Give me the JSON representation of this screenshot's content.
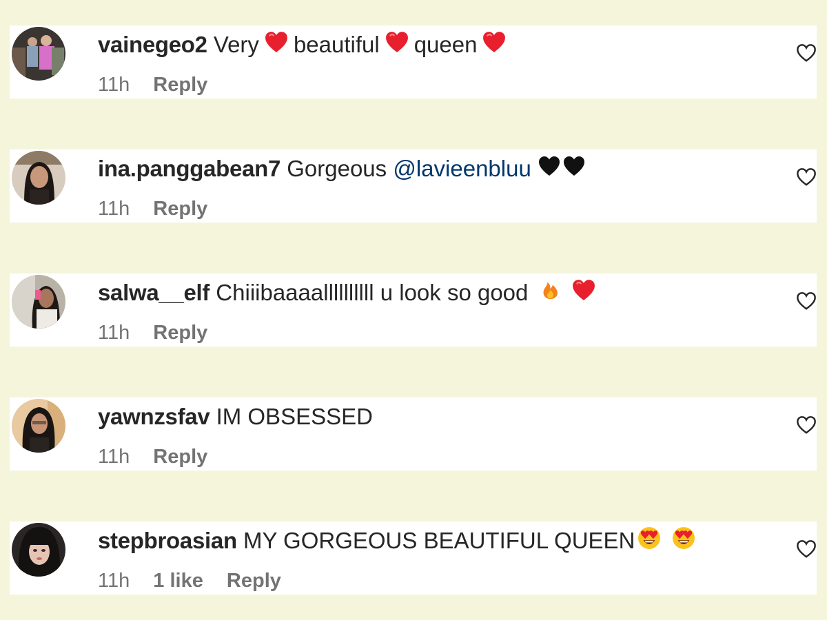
{
  "comments": [
    {
      "username": "vainegeo2",
      "segments": [
        "Very",
        "beautiful",
        "queen"
      ],
      "emoji": [
        "red-heart",
        "red-heart",
        "red-heart"
      ],
      "time": "11h",
      "likes": "",
      "reply": "Reply"
    },
    {
      "username": "ina.panggabean7",
      "text": "Gorgeous",
      "mention": "@lavieenbluu",
      "emoji": [
        "black-heart",
        "black-heart"
      ],
      "time": "11h",
      "likes": "",
      "reply": "Reply"
    },
    {
      "username": "salwa__elf",
      "text": "Chiiibaaaallllllllll u look so good",
      "emoji": [
        "fire",
        "red-heart"
      ],
      "time": "11h",
      "likes": "",
      "reply": "Reply"
    },
    {
      "username": "yawnzsfav",
      "text": "IM OBSESSED",
      "time": "11h",
      "likes": "",
      "reply": "Reply"
    },
    {
      "username": "stepbroasian",
      "text": "MY GORGEOUS BEAUTIFUL QUEEN",
      "emoji": [
        "heart-eyes-face",
        "heart-eyes-face"
      ],
      "time": "11h",
      "likes": "1 like",
      "reply": "Reply"
    }
  ],
  "colors": {
    "background": "#f5f5dc",
    "card": "#ffffff",
    "text": "#262626",
    "meta": "#737373",
    "mention": "#00376b",
    "heart_red": "#e8202e"
  }
}
